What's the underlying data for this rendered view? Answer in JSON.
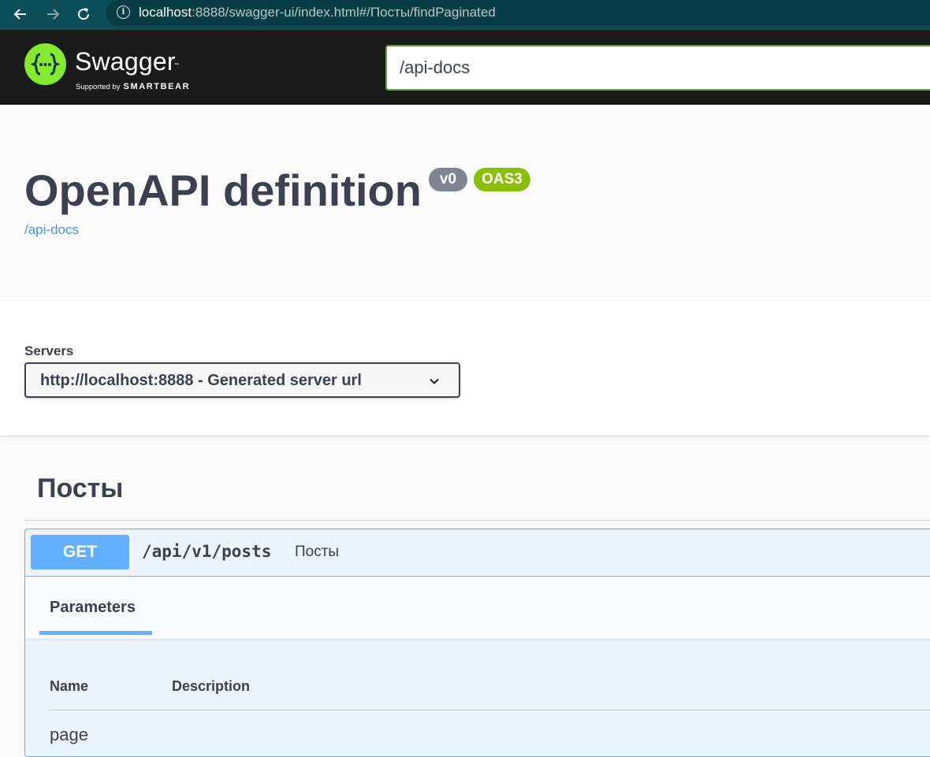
{
  "browser": {
    "url_host": "localhost",
    "url_path": ":8888/swagger-ui/index.html#/Посты/findPaginated"
  },
  "topbar": {
    "logo_text": "Swagger",
    "logo_tm": "™",
    "supported_by": "Supported by",
    "brand": "SMARTBEAR",
    "spec_url": "/api-docs"
  },
  "info": {
    "title": "OpenAPI definition",
    "version": "v0",
    "oas": "OAS3",
    "docs_link": "/api-docs"
  },
  "servers": {
    "label": "Servers",
    "selected": "http://localhost:8888 - Generated server url"
  },
  "tag": {
    "name": "Посты"
  },
  "operation": {
    "method": "GET",
    "path": "/api/v1/posts",
    "description": "Посты",
    "tab": "Parameters",
    "columns": [
      "Name",
      "Description"
    ],
    "params": [
      "page"
    ]
  },
  "colors": {
    "topbar": "#1b1b1b",
    "swagger_green": "#85ea2d",
    "get_blue": "#61affe",
    "link": "#4990e2",
    "oas_badge": "#89bf04"
  }
}
